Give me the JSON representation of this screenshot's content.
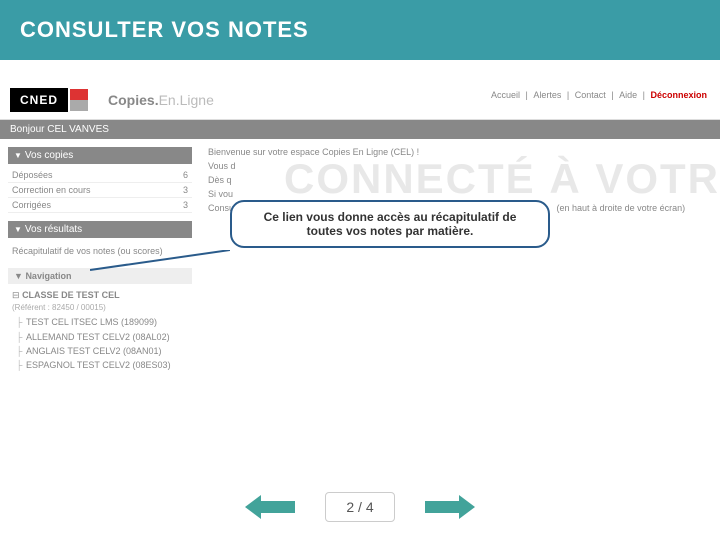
{
  "header": {
    "title": "CONSULTER VOS NOTES"
  },
  "branding": {
    "logo": "CNED",
    "app_bold": "Copies.",
    "app_light": "En.Ligne"
  },
  "bg_text": "CONNECTÉ À VOTR",
  "topnav": {
    "accueil": "Accueil",
    "alertes": "Alertes",
    "contact": "Contact",
    "aide": "Aide",
    "deco": "Déconnexion"
  },
  "greeting": "Bonjour CEL VANVES",
  "sidebar": {
    "copies_hdr": "Vos copies",
    "rows": [
      {
        "label": "Déposées",
        "count": "6"
      },
      {
        "label": "Correction en cours",
        "count": "3"
      },
      {
        "label": "Corrigées",
        "count": "3"
      }
    ],
    "resultats_hdr": "Vos résultats",
    "recap": "Récapitulatif de vos notes (ou scores)",
    "nav_hdr": "Navigation"
  },
  "tree": {
    "root": "CLASSE DE TEST CEL",
    "ref": "(Référent : 82450 / 00015)",
    "items": [
      "TEST CEL ITSEC LMS (189099)",
      "ALLEMAND TEST CELV2 (08AL02)",
      "ANGLAIS TEST CELV2 (08AN01)",
      "ESPAGNOL TEST CELV2 (08ES03)"
    ]
  },
  "content": {
    "welcome": "Bienvenue sur votre espace Copies En Ligne (CEL) !",
    "l1": "Vous d",
    "l2": "Dès q",
    "l3": "Si vou",
    "l4": "Consu",
    "tail": "(en haut à droite de votre écran)"
  },
  "callout": "Ce lien vous donne accès au récapitulatif de toutes vos notes par matière.",
  "pager": {
    "current": "2",
    "sep": "/",
    "total": "4"
  },
  "colors": {
    "teal": "#3a9ca6",
    "arrow": "#42a39a",
    "callout_border": "#2a5b8b"
  }
}
